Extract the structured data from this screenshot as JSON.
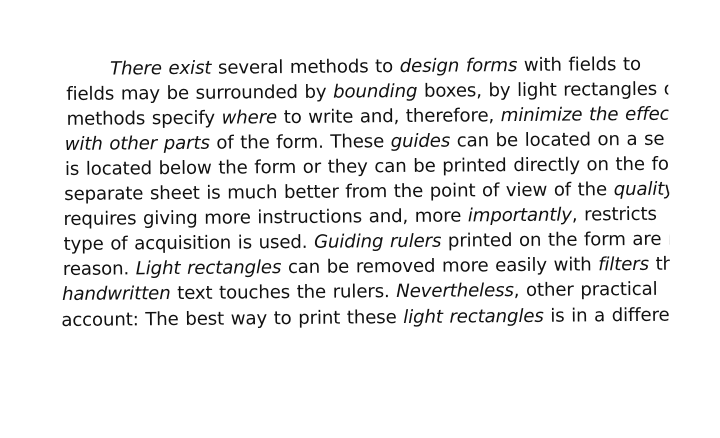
{
  "lines": [
    [
      {
        "t": "There exist",
        "i": true
      },
      {
        "t": " several methods to ",
        "i": false
      },
      {
        "t": "design forms",
        "i": true
      },
      {
        "t": " with fields to",
        "i": false
      }
    ],
    [
      {
        "t": "fields may be surrounded by ",
        "i": false
      },
      {
        "t": "bounding",
        "i": true
      },
      {
        "t": " boxes, by light rectangles o",
        "i": false
      }
    ],
    [
      {
        "t": "methods specify ",
        "i": false
      },
      {
        "t": "where",
        "i": true
      },
      {
        "t": " to write and, therefore, ",
        "i": false
      },
      {
        "t": "minimize the effec",
        "i": true
      }
    ],
    [
      {
        "t": "with other parts",
        "i": true
      },
      {
        "t": " of the form. These ",
        "i": false
      },
      {
        "t": "guides",
        "i": true
      },
      {
        "t": " can be located on a se",
        "i": false
      }
    ],
    [
      {
        "t": "is located below the form or they can be printed directly on the for",
        "i": false
      }
    ],
    [
      {
        "t": "separate sheet is much better from the point of view of the ",
        "i": false
      },
      {
        "t": "quality",
        "i": true
      }
    ],
    [
      {
        "t": "requires giving more instructions and, more ",
        "i": false
      },
      {
        "t": "importantly",
        "i": true
      },
      {
        "t": ", restricts",
        "i": false
      }
    ],
    [
      {
        "t": "type of acquisition is used. ",
        "i": false
      },
      {
        "t": "Guiding rulers",
        "i": true
      },
      {
        "t": " printed on the form are m",
        "i": false
      }
    ],
    [
      {
        "t": "reason. ",
        "i": false
      },
      {
        "t": "Light rectangles",
        "i": true
      },
      {
        "t": " can be removed more easily with ",
        "i": false
      },
      {
        "t": "filters",
        "i": true
      },
      {
        "t": " th",
        "i": false
      }
    ],
    [
      {
        "t": "handwritten",
        "i": true
      },
      {
        "t": " text touches the rulers. ",
        "i": false
      },
      {
        "t": "Nevertheless",
        "i": true
      },
      {
        "t": ", other practical",
        "i": false
      }
    ],
    [
      {
        "t": "account: The best way to print these ",
        "i": false
      },
      {
        "t": "light rectangles",
        "i": true
      },
      {
        "t": " is in a differe",
        "i": false
      }
    ]
  ]
}
